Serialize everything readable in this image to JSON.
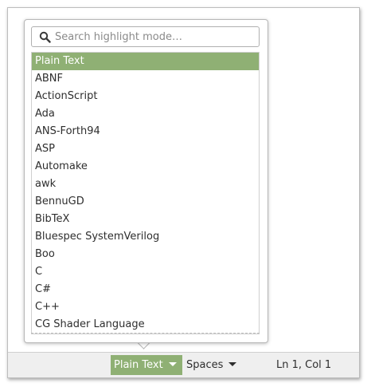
{
  "search": {
    "placeholder": "Search highlight mode…",
    "value": ""
  },
  "modes": [
    {
      "label": "Plain Text",
      "selected": true
    },
    {
      "label": "ABNF"
    },
    {
      "label": "ActionScript"
    },
    {
      "label": "Ada"
    },
    {
      "label": "ANS-Forth94"
    },
    {
      "label": "ASP"
    },
    {
      "label": "Automake"
    },
    {
      "label": "awk"
    },
    {
      "label": "BennuGD"
    },
    {
      "label": "BibTeX"
    },
    {
      "label": "Bluespec SystemVerilog"
    },
    {
      "label": "Boo"
    },
    {
      "label": "C"
    },
    {
      "label": "C#"
    },
    {
      "label": "C++"
    },
    {
      "label": "CG Shader Language"
    }
  ],
  "statusbar": {
    "mode_label": "Plain Text",
    "indent_label": "Spaces",
    "position_label": "Ln 1, Col 1"
  },
  "colors": {
    "accent": "#8fb074",
    "statusbar_bg": "#efefef"
  },
  "icons": {
    "search": "magnifier",
    "dropdown": "triangle-down"
  }
}
